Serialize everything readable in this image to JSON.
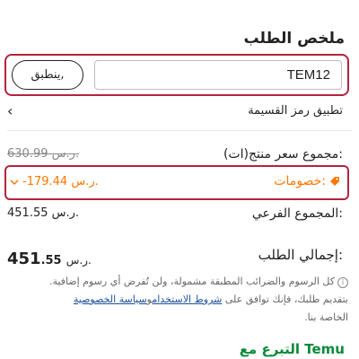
{
  "page": {
    "title": "ملخص الطلب"
  },
  "coupon": {
    "code_value": "TEM12",
    "apply_label": "ينطبق,"
  },
  "apply_code": {
    "label": "تطبيق رمز القسيمة"
  },
  "subtotal_items": {
    "label": "مجموع سعر منتج(ات):",
    "value": "630.99 ر.س."
  },
  "discounts": {
    "label": "خصومات:",
    "value": "-179.44 ر.س."
  },
  "subtotal": {
    "label": "المجموع الفرعي:",
    "value": "451.55 ر.س."
  },
  "total": {
    "label": "إجمالي الطلب:",
    "currency": "ر.س.",
    "major": "451",
    "minor": ".55"
  },
  "note": {
    "line1": "كل الرسوم والضرائب المطبقة مشمولة، ولن تُفرض أي رسوم إضافية.",
    "line2_prefix": "بتقديم طلبك، فإنك توافق على ",
    "terms_link": "شروط الاستخدام",
    "and": "و",
    "privacy_link": "سياسة الخصوصية",
    "line3": "الخاصة بنا."
  },
  "donate": {
    "label": "التبرع مع Temu"
  },
  "colors": {
    "accent": "#fb7701",
    "highlight_border": "#b4233f",
    "link": "#1a4f9c",
    "green": "#0a8a3a"
  }
}
